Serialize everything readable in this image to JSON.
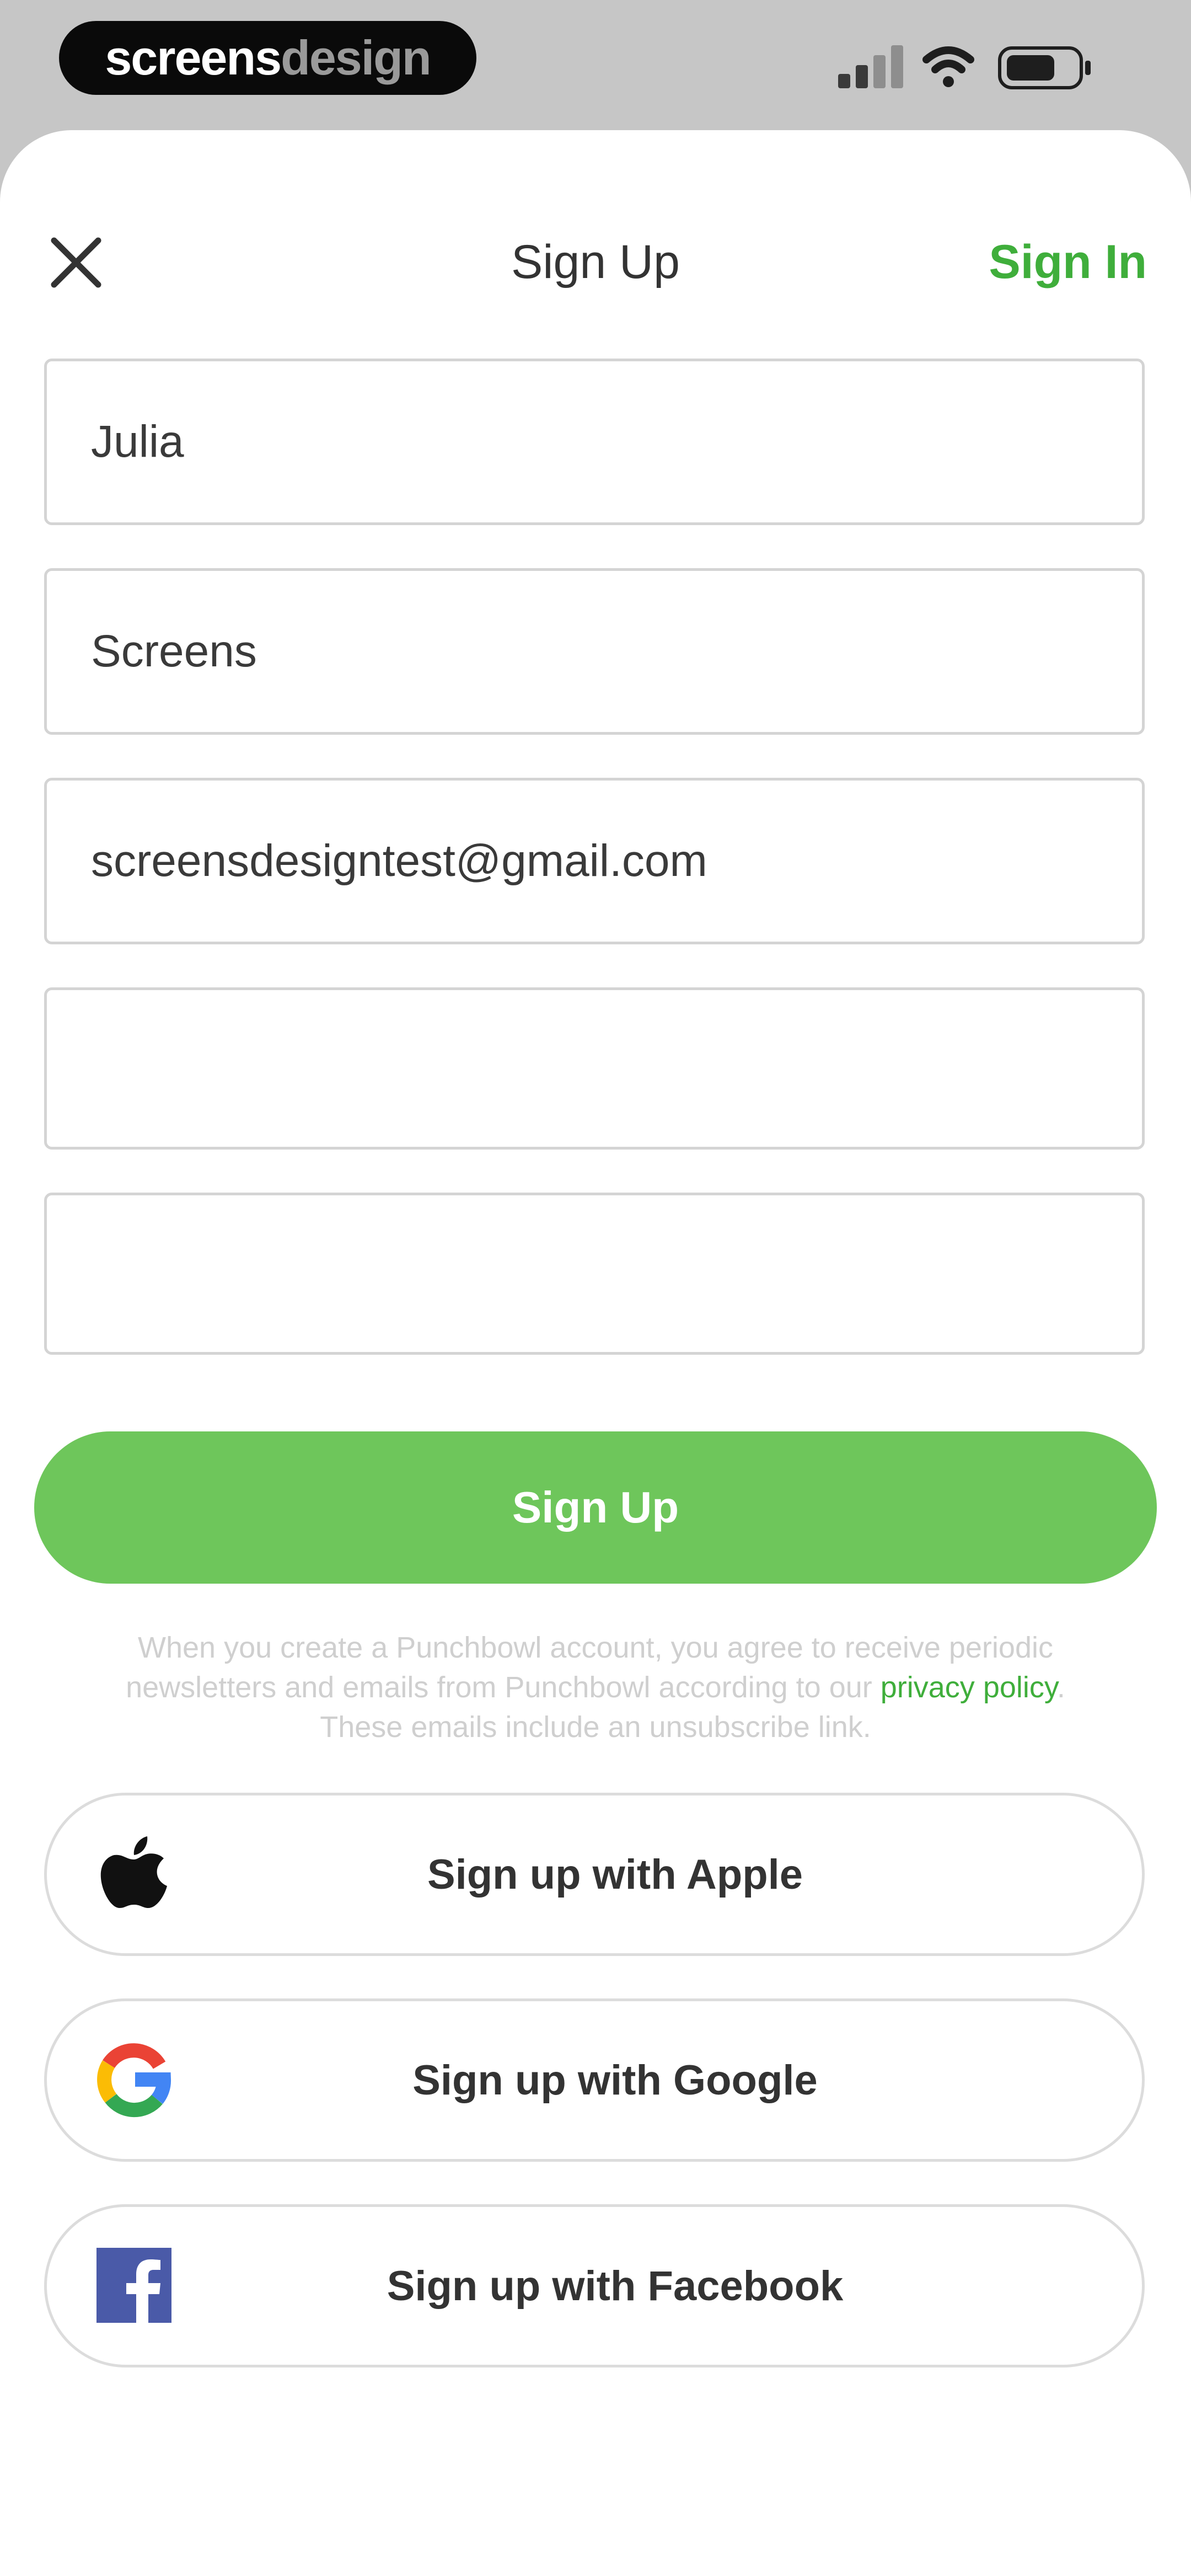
{
  "status_bar": {
    "brand_part1": "screens",
    "brand_part2": "design"
  },
  "header": {
    "title": "Sign Up",
    "sign_in": "Sign In"
  },
  "form": {
    "first_name": "Julia",
    "last_name": "Screens",
    "email": "screensdesigntest@gmail.com",
    "field4": "",
    "field5": "",
    "submit": "Sign Up"
  },
  "legal": {
    "text_before": "When you create a Punchbowl account, you agree to receive periodic newsletters and emails from Punchbowl according to our ",
    "link": "privacy policy",
    "text_after": ". These emails include an unsubscribe link."
  },
  "social": {
    "apple": "Sign up with Apple",
    "google": "Sign up with Google",
    "facebook": "Sign up with Facebook"
  },
  "colors": {
    "accent_green": "#3fae3b",
    "button_green": "#6ec65b",
    "facebook_blue": "#4a5aa8"
  }
}
